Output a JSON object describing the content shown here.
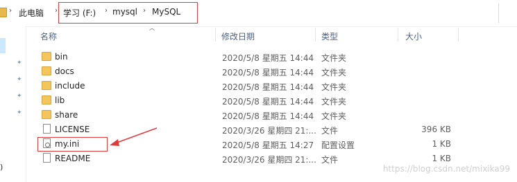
{
  "address": {
    "crumbs": [
      "此电脑",
      "学习 (F:)",
      "mysql",
      "MySQL"
    ],
    "separator": "›"
  },
  "columns": {
    "name": "名称",
    "date": "修改日期",
    "type": "类型",
    "size": "大小"
  },
  "files": [
    {
      "name": "bin",
      "date": "2020/5/8 星期五 14:44",
      "type": "文件夹",
      "size": "",
      "icon": "folder-icon"
    },
    {
      "name": "docs",
      "date": "2020/5/8 星期五 14:44",
      "type": "文件夹",
      "size": "",
      "icon": "folder-icon"
    },
    {
      "name": "include",
      "date": "2020/5/8 星期五 14:44",
      "type": "文件夹",
      "size": "",
      "icon": "folder-icon"
    },
    {
      "name": "lib",
      "date": "2020/5/8 星期五 14:44",
      "type": "文件夹",
      "size": "",
      "icon": "folder-icon"
    },
    {
      "name": "share",
      "date": "2020/5/8 星期五 14:44",
      "type": "文件夹",
      "size": "",
      "icon": "folder-icon"
    },
    {
      "name": "LICENSE",
      "date": "2020/3/26 星期四 21:...",
      "type": "文件",
      "size": "396 KB",
      "icon": "file-icon"
    },
    {
      "name": "my.ini",
      "date": "2020/5/8 星期五 14:27",
      "type": "配置设置",
      "size": "1 KB",
      "icon": "ini-file-icon"
    },
    {
      "name": "README",
      "date": "2020/3/26 星期四 21:...",
      "type": "文件",
      "size": "1 KB",
      "icon": "file-icon"
    }
  ],
  "left_pane": {
    "partial_text": ")"
  },
  "watermark": "https://blog.csdn.net/mixika99",
  "colors": {
    "highlight": "#e03a3a",
    "folder": "#f3c55a",
    "header_text": "#4d6082"
  }
}
